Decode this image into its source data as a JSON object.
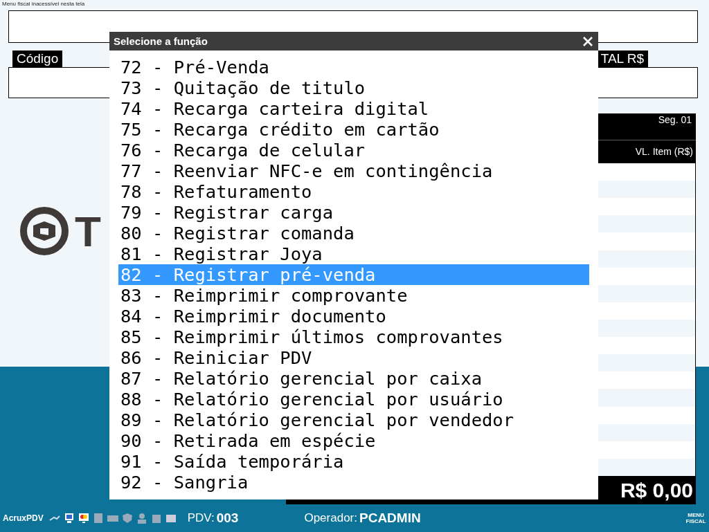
{
  "background": {
    "notice": "Menu fiscal inacessível nesta tela",
    "code_label": "Código",
    "total_label": "TAL R$",
    "logo_text": "T",
    "segment": "Seg. 01",
    "item_value_header": "VL. Item (R$)",
    "total": "R$ 0,00"
  },
  "dialog": {
    "title": "Selecione a função",
    "items": [
      {
        "label": "72 - Pré-Venda",
        "selected": false
      },
      {
        "label": "73 - Quitação de titulo",
        "selected": false
      },
      {
        "label": "74 - Recarga carteira digital",
        "selected": false
      },
      {
        "label": "75 - Recarga crédito em cartão",
        "selected": false
      },
      {
        "label": "76 - Recarga de celular",
        "selected": false
      },
      {
        "label": "77 - Reenviar NFC-e em contingência",
        "selected": false
      },
      {
        "label": "78 - Refaturamento",
        "selected": false
      },
      {
        "label": "79 - Registrar carga",
        "selected": false
      },
      {
        "label": "80 - Registrar comanda",
        "selected": false
      },
      {
        "label": "81 - Registrar Joya",
        "selected": false
      },
      {
        "label": "82 - Registrar pré-venda",
        "selected": true
      },
      {
        "label": "83 - Reimprimir comprovante",
        "selected": false
      },
      {
        "label": "84 - Reimprimir documento",
        "selected": false
      },
      {
        "label": "85 - Reimprimir últimos comprovantes",
        "selected": false
      },
      {
        "label": "86 - Reiniciar PDV",
        "selected": false
      },
      {
        "label": "87 - Relatório gerencial por caixa",
        "selected": false
      },
      {
        "label": "88 - Relatório gerencial por usuário",
        "selected": false
      },
      {
        "label": "89 - Relatório gerencial por vendedor",
        "selected": false
      },
      {
        "label": "90 - Retirada em espécie",
        "selected": false
      },
      {
        "label": "91 - Saída temporária",
        "selected": false
      },
      {
        "label": "92 - Sangria",
        "selected": false
      }
    ]
  },
  "status_bar": {
    "app_name": "AcruxPDV",
    "pdv_label": "PDV:",
    "pdv": "003",
    "operator_label": "Operador:",
    "operator": "PCADMIN",
    "menu_fiscal": "MENU FISCAL"
  }
}
